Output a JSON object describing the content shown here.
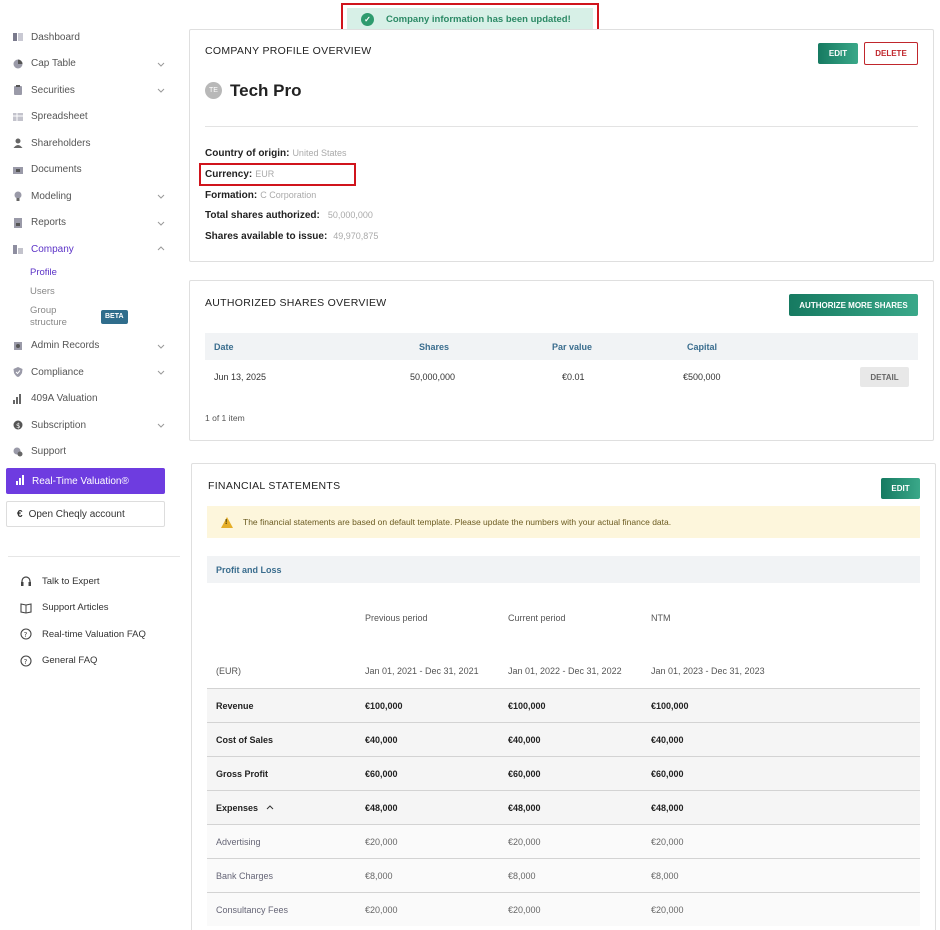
{
  "toast": {
    "message": "Company information has been updated!"
  },
  "sidebar": {
    "items": [
      {
        "label": "Dashboard",
        "icon": "dashboard-icon",
        "chevron": false
      },
      {
        "label": "Cap Table",
        "icon": "pie-chart-icon",
        "chevron": true
      },
      {
        "label": "Securities",
        "icon": "clipboard-icon",
        "chevron": true
      },
      {
        "label": "Spreadsheet",
        "icon": "spreadsheet-icon",
        "chevron": false
      },
      {
        "label": "Shareholders",
        "icon": "person-icon",
        "chevron": false
      },
      {
        "label": "Documents",
        "icon": "folder-icon",
        "chevron": false
      },
      {
        "label": "Modeling",
        "icon": "lightbulb-icon",
        "chevron": true
      },
      {
        "label": "Reports",
        "icon": "report-icon",
        "chevron": true
      },
      {
        "label": "Company",
        "icon": "building-icon",
        "chevron": true
      }
    ],
    "company_sub": {
      "profile": "Profile",
      "users": "Users",
      "group_line1": "Group",
      "group_line2": "structure",
      "beta": "BETA"
    },
    "items2": [
      {
        "label": "Admin Records",
        "icon": "admin-records-icon",
        "chevron": true
      },
      {
        "label": "Compliance",
        "icon": "shield-icon",
        "chevron": true
      },
      {
        "label": "409A Valuation",
        "icon": "chart-icon",
        "chevron": false
      },
      {
        "label": "Subscription",
        "icon": "dollar-icon",
        "chevron": true
      },
      {
        "label": "Support",
        "icon": "support-icon",
        "chevron": false
      }
    ],
    "rtv_label": "Real-Time Valuation®",
    "cheqly_label": "Open Cheqly account",
    "help": [
      {
        "label": "Talk to Expert",
        "icon": "headset-icon"
      },
      {
        "label": "Support Articles",
        "icon": "book-icon"
      },
      {
        "label": "Real-time Valuation FAQ",
        "icon": "question-circle-icon"
      },
      {
        "label": "General FAQ",
        "icon": "question-circle-icon"
      }
    ]
  },
  "profile": {
    "title": "COMPANY PROFILE OVERVIEW",
    "edit": "EDIT",
    "delete": "DELETE",
    "avatar": "TE",
    "name": "Tech Pro",
    "fields": {
      "country_label": "Country of origin:",
      "country": "United States",
      "currency_label": "Currency:",
      "currency": "EUR",
      "formation_label": "Formation:",
      "formation": "C Corporation",
      "authorized_label": "Total shares authorized:",
      "authorized": "50,000,000",
      "available_label": "Shares available to issue:",
      "available": "49,970,875"
    }
  },
  "authorized": {
    "title": "AUTHORIZED SHARES OVERVIEW",
    "button": "AUTHORIZE MORE SHARES",
    "columns": [
      "Date",
      "Shares",
      "Par value",
      "Capital"
    ],
    "row": {
      "date": "Jun 13, 2025",
      "shares": "50,000,000",
      "par": "€0.01",
      "capital": "€500,000",
      "action": "DETAIL"
    },
    "footer": "1 of 1 item"
  },
  "financial": {
    "title": "FINANCIAL STATEMENTS",
    "edit": "EDIT",
    "warning": "The financial statements are based on default template. Please update the numbers with your actual finance data.",
    "section": "Profit and Loss",
    "headers": [
      "Previous period",
      "Current period",
      "NTM"
    ],
    "currency": "(EUR)",
    "periods": [
      "Jan 01, 2021 - Dec 31, 2021",
      "Jan 01, 2022 - Dec 31, 2022",
      "Jan 01, 2023 - Dec 31, 2023"
    ],
    "rows": [
      {
        "label": "Revenue",
        "v1": "€100,000",
        "v2": "€100,000",
        "v3": "€100,000"
      },
      {
        "label": "Cost of Sales",
        "v1": "€40,000",
        "v2": "€40,000",
        "v3": "€40,000"
      },
      {
        "label": "Gross Profit",
        "v1": "€60,000",
        "v2": "€60,000",
        "v3": "€60,000"
      },
      {
        "label": "Expenses",
        "v1": "€48,000",
        "v2": "€48,000",
        "v3": "€48,000"
      },
      {
        "label": "Advertising",
        "v1": "€20,000",
        "v2": "€20,000",
        "v3": "€20,000"
      },
      {
        "label": "Bank Charges",
        "v1": "€8,000",
        "v2": "€8,000",
        "v3": "€8,000"
      },
      {
        "label": "Consultancy Fees",
        "v1": "€20,000",
        "v2": "€20,000",
        "v3": "€20,000"
      }
    ]
  }
}
